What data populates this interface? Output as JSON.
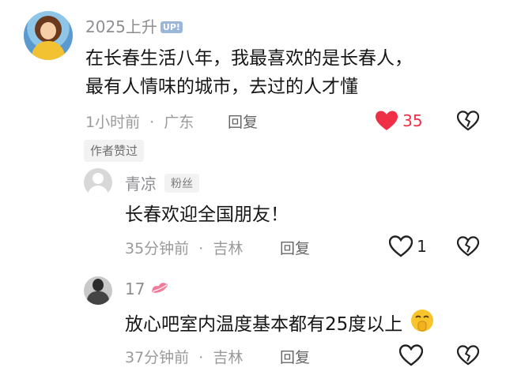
{
  "comments": [
    {
      "username": "2025上升",
      "badge": "UP!",
      "content_line1": "在长春生活八年，我最喜欢的是长春人，",
      "content_line2": "最有人情味的城市，去过的人才懂",
      "time": "1小时前",
      "location": "广东",
      "reply_label": "回复",
      "like_count": "35",
      "liked": true,
      "author_tag": "作者赞过"
    }
  ],
  "replies": [
    {
      "username": "青凉",
      "tag": "粉丝",
      "content": "长春欢迎全国朋友！",
      "time": "35分钟前",
      "location": "吉林",
      "reply_label": "回复",
      "like_count": "1"
    },
    {
      "username": "17",
      "content": "放心吧室内温度基本都有25度以上",
      "time": "37分钟前",
      "location": "吉林",
      "reply_label": "回复",
      "like_count": ""
    }
  ],
  "separator": "·",
  "icons": {
    "like": "heart-icon",
    "dislike": "broken-heart-icon",
    "lips": "lips-icon",
    "emoji": "shushing-face-icon"
  },
  "colors": {
    "liked": "#ef2f46",
    "icon_gray": "#222222",
    "meta": "#9a9a9a"
  }
}
